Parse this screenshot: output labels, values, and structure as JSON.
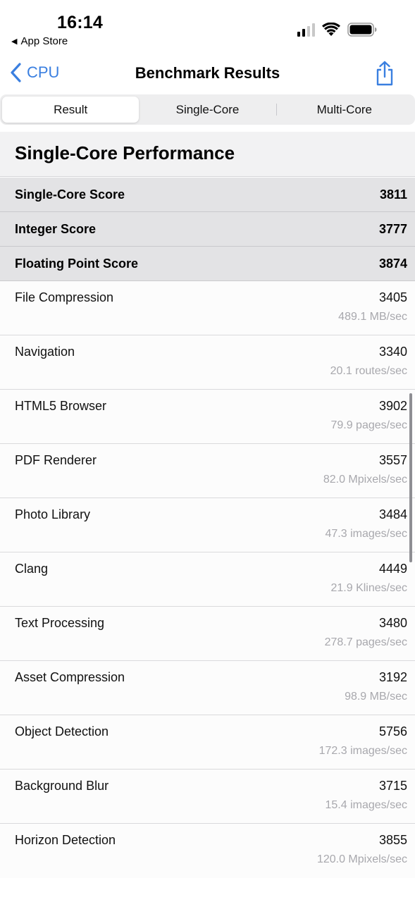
{
  "status": {
    "time": "16:14",
    "back_app": "App Store"
  },
  "nav": {
    "back_label": "CPU",
    "title": "Benchmark Results"
  },
  "tabs": [
    {
      "label": "Result",
      "active": true
    },
    {
      "label": "Single-Core",
      "active": false
    },
    {
      "label": "Multi-Core",
      "active": false
    }
  ],
  "section": {
    "title": "Single-Core Performance"
  },
  "scores": [
    {
      "label": "Single-Core Score",
      "value": "3811"
    },
    {
      "label": "Integer Score",
      "value": "3777"
    },
    {
      "label": "Floating Point Score",
      "value": "3874"
    }
  ],
  "benchmarks": [
    {
      "name": "File Compression",
      "score": "3405",
      "rate": "489.1 MB/sec"
    },
    {
      "name": "Navigation",
      "score": "3340",
      "rate": "20.1 routes/sec"
    },
    {
      "name": "HTML5 Browser",
      "score": "3902",
      "rate": "79.9 pages/sec"
    },
    {
      "name": "PDF Renderer",
      "score": "3557",
      "rate": "82.0 Mpixels/sec"
    },
    {
      "name": "Photo Library",
      "score": "3484",
      "rate": "47.3 images/sec"
    },
    {
      "name": "Clang",
      "score": "4449",
      "rate": "21.9 Klines/sec"
    },
    {
      "name": "Text Processing",
      "score": "3480",
      "rate": "278.7 pages/sec"
    },
    {
      "name": "Asset Compression",
      "score": "3192",
      "rate": "98.9 MB/sec"
    },
    {
      "name": "Object Detection",
      "score": "5756",
      "rate": "172.3 images/sec"
    },
    {
      "name": "Background Blur",
      "score": "3715",
      "rate": "15.4 images/sec"
    },
    {
      "name": "Horizon Detection",
      "score": "3855",
      "rate": "120.0 Mpixels/sec"
    }
  ],
  "colors": {
    "accent": "#3a7fe0",
    "score_row_bg": "#e3e3e5",
    "rate_text": "#a8a8ad"
  },
  "icons": {
    "back": "chevron-left-icon",
    "share": "share-icon",
    "signal": "cellular-signal-icon",
    "wifi": "wifi-icon",
    "battery": "battery-icon"
  }
}
